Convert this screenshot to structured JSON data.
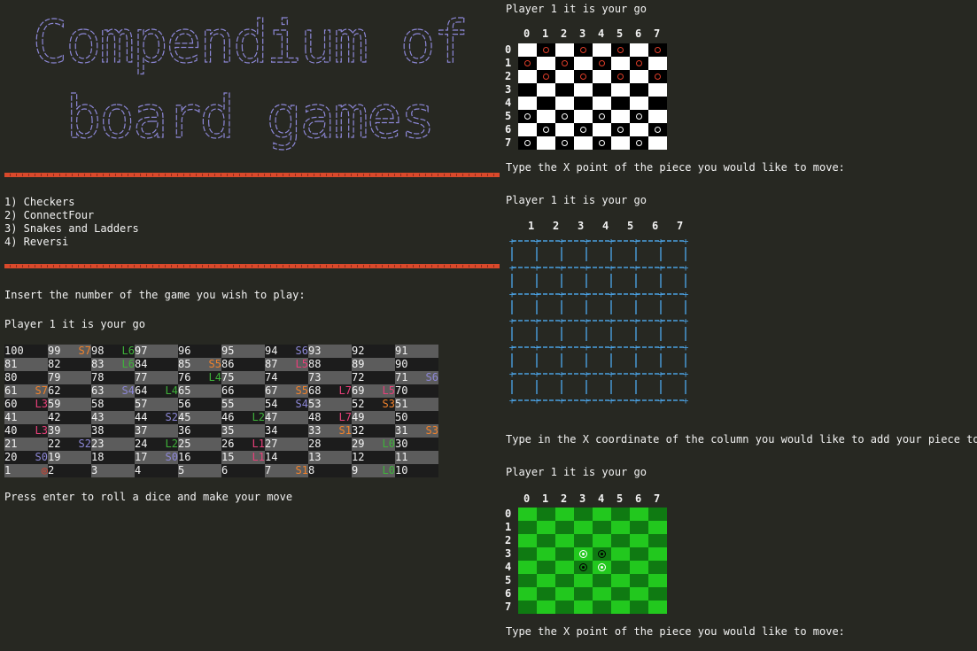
{
  "banner": {
    "line1": "Compendium of",
    "line2": "board games"
  },
  "menu": {
    "items": [
      "1) Checkers",
      "2) ConnectFour",
      "3) Snakes and Ladders",
      "4) Reversi"
    ],
    "prompt": "Insert the number of the game you wish to play:"
  },
  "snakes": {
    "player_prompt": "Player 1 it is your go",
    "footer": "Press enter to roll a dice and make your move",
    "rows": [
      [
        [
          "100",
          ""
        ],
        [
          "99",
          "S7"
        ],
        [
          "98",
          "L6"
        ],
        [
          "97",
          ""
        ],
        [
          "96",
          ""
        ],
        [
          "95",
          ""
        ],
        [
          "94",
          "S6"
        ],
        [
          "93",
          ""
        ],
        [
          "92",
          ""
        ],
        [
          "91",
          ""
        ]
      ],
      [
        [
          "81",
          ""
        ],
        [
          "82",
          ""
        ],
        [
          "83",
          "L6"
        ],
        [
          "84",
          ""
        ],
        [
          "85",
          "S5"
        ],
        [
          "86",
          ""
        ],
        [
          "87",
          "L5"
        ],
        [
          "88",
          ""
        ],
        [
          "89",
          ""
        ],
        [
          "90",
          ""
        ]
      ],
      [
        [
          "80",
          ""
        ],
        [
          "79",
          ""
        ],
        [
          "78",
          ""
        ],
        [
          "77",
          ""
        ],
        [
          "76",
          "L4"
        ],
        [
          "75",
          ""
        ],
        [
          "74",
          ""
        ],
        [
          "73",
          ""
        ],
        [
          "72",
          ""
        ],
        [
          "71",
          "S6"
        ]
      ],
      [
        [
          "61",
          "S7"
        ],
        [
          "62",
          ""
        ],
        [
          "63",
          "S4"
        ],
        [
          "64",
          "L4"
        ],
        [
          "65",
          ""
        ],
        [
          "66",
          ""
        ],
        [
          "67",
          "S5"
        ],
        [
          "68",
          "L7"
        ],
        [
          "69",
          "L5"
        ],
        [
          "70",
          ""
        ]
      ],
      [
        [
          "60",
          "L3"
        ],
        [
          "59",
          ""
        ],
        [
          "58",
          ""
        ],
        [
          "57",
          ""
        ],
        [
          "56",
          ""
        ],
        [
          "55",
          ""
        ],
        [
          "54",
          "S4"
        ],
        [
          "53",
          ""
        ],
        [
          "52",
          "S3"
        ],
        [
          "51",
          ""
        ]
      ],
      [
        [
          "41",
          ""
        ],
        [
          "42",
          ""
        ],
        [
          "43",
          ""
        ],
        [
          "44",
          "S2"
        ],
        [
          "45",
          ""
        ],
        [
          "46",
          "L2"
        ],
        [
          "47",
          ""
        ],
        [
          "48",
          "L7"
        ],
        [
          "49",
          ""
        ],
        [
          "50",
          ""
        ]
      ],
      [
        [
          "40",
          "L3"
        ],
        [
          "39",
          ""
        ],
        [
          "38",
          ""
        ],
        [
          "37",
          ""
        ],
        [
          "36",
          ""
        ],
        [
          "35",
          ""
        ],
        [
          "34",
          ""
        ],
        [
          "33",
          "S1"
        ],
        [
          "32",
          ""
        ],
        [
          "31",
          "S3"
        ]
      ],
      [
        [
          "21",
          ""
        ],
        [
          "22",
          "S2"
        ],
        [
          "23",
          ""
        ],
        [
          "24",
          "L2"
        ],
        [
          "25",
          ""
        ],
        [
          "26",
          "L1"
        ],
        [
          "27",
          ""
        ],
        [
          "28",
          ""
        ],
        [
          "29",
          "L0"
        ],
        [
          "30",
          ""
        ]
      ],
      [
        [
          "20",
          "S0"
        ],
        [
          "19",
          ""
        ],
        [
          "18",
          ""
        ],
        [
          "17",
          "S0"
        ],
        [
          "16",
          ""
        ],
        [
          "15",
          "L1"
        ],
        [
          "14",
          ""
        ],
        [
          "13",
          ""
        ],
        [
          "12",
          ""
        ],
        [
          "11",
          ""
        ]
      ],
      [
        [
          "1",
          "◎"
        ],
        [
          "2",
          ""
        ],
        [
          "3",
          ""
        ],
        [
          "4",
          ""
        ],
        [
          "5",
          ""
        ],
        [
          "6",
          ""
        ],
        [
          "7",
          "S1"
        ],
        [
          "8",
          ""
        ],
        [
          "9",
          "L0"
        ],
        [
          "10",
          ""
        ]
      ]
    ]
  },
  "checkers": {
    "player_prompt": "Player 1 it is your go",
    "col_labels": [
      "0",
      "1",
      "2",
      "3",
      "4",
      "5",
      "6",
      "7"
    ],
    "row_labels": [
      "0",
      "1",
      "2",
      "3",
      "4",
      "5",
      "6",
      "7"
    ],
    "pieces_red": [
      [
        0,
        1
      ],
      [
        0,
        3
      ],
      [
        0,
        5
      ],
      [
        0,
        7
      ],
      [
        1,
        0
      ],
      [
        1,
        2
      ],
      [
        1,
        4
      ],
      [
        1,
        6
      ],
      [
        2,
        1
      ],
      [
        2,
        3
      ],
      [
        2,
        5
      ],
      [
        2,
        7
      ]
    ],
    "pieces_white": [
      [
        5,
        0
      ],
      [
        5,
        2
      ],
      [
        5,
        4
      ],
      [
        5,
        6
      ],
      [
        6,
        1
      ],
      [
        6,
        3
      ],
      [
        6,
        5
      ],
      [
        6,
        7
      ],
      [
        7,
        0
      ],
      [
        7,
        2
      ],
      [
        7,
        4
      ],
      [
        7,
        6
      ]
    ],
    "footer": "Type the X point of the piece you would like to move:"
  },
  "connect": {
    "player_prompt": "Player 1 it is your go",
    "col_labels": [
      "1",
      "2",
      "3",
      "4",
      "5",
      "6",
      "7"
    ],
    "footer": "Type in the X coordinate of the column you would like to add your piece to:"
  },
  "reversi": {
    "player_prompt": "Player 1 it is your go",
    "col_labels": [
      "0",
      "1",
      "2",
      "3",
      "4",
      "5",
      "6",
      "7"
    ],
    "row_labels": [
      "0",
      "1",
      "2",
      "3",
      "4",
      "5",
      "6",
      "7"
    ],
    "pieces": [
      [
        3,
        3,
        "white"
      ],
      [
        3,
        4,
        "black"
      ],
      [
        4,
        3,
        "black"
      ],
      [
        4,
        4,
        "white"
      ]
    ],
    "footer": "Type the X point of the piece you would like to move:"
  },
  "colors": {
    "background": "#272822",
    "banner": "#8c87d6",
    "rule": "#d9492b",
    "grid_blue": "#4a9fe0",
    "green_light": "#22c81e",
    "green_dark": "#0f7a12",
    "snake_orange": "#f0822c",
    "snake_purple": "#8c87d6",
    "ladder_green": "#3fb23a",
    "ladder_pink": "#e8407a",
    "piece_red": "#e03e2a"
  }
}
